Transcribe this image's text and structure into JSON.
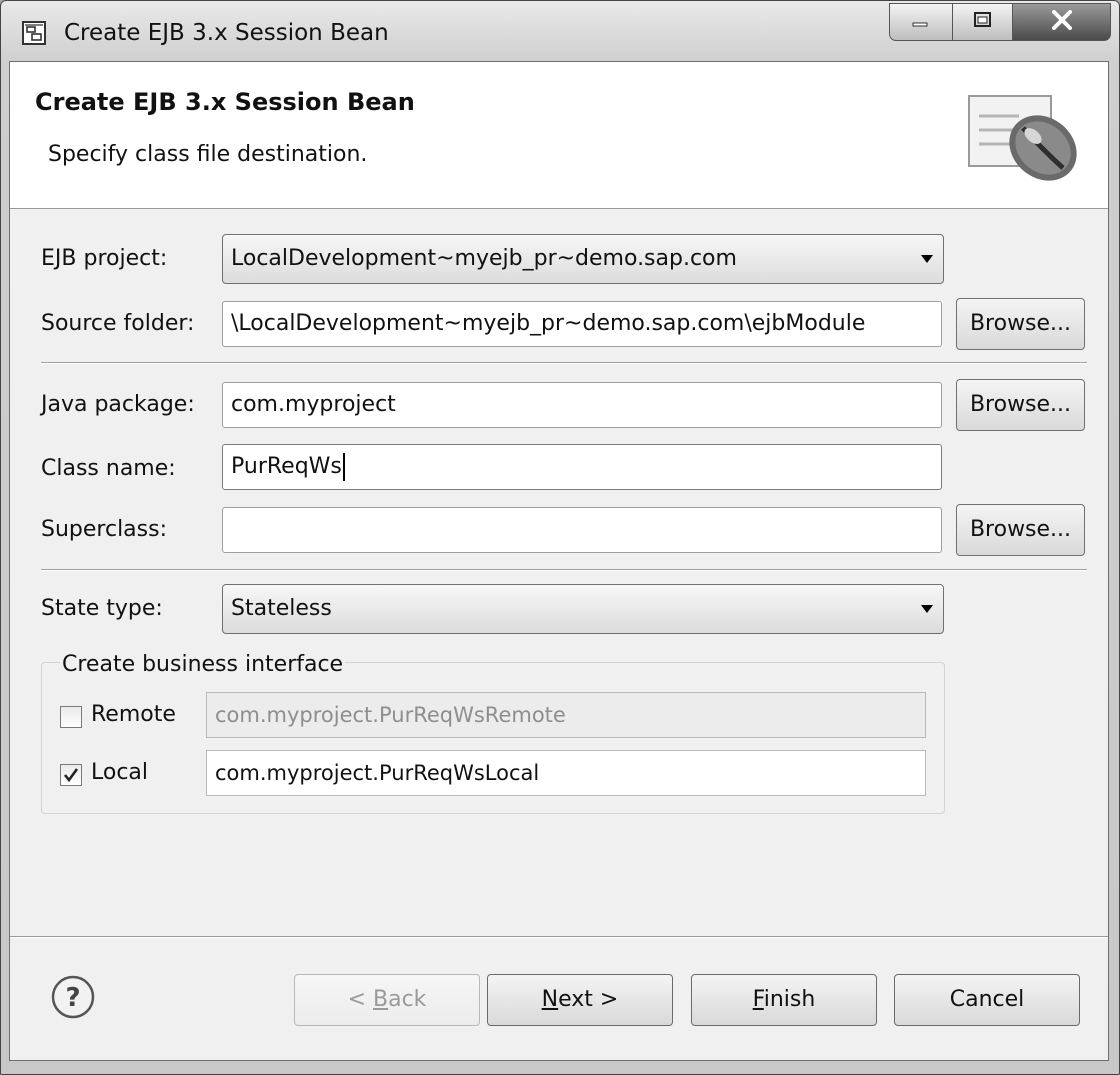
{
  "window": {
    "title": "Create EJB 3.x Session Bean"
  },
  "banner": {
    "title": "Create EJB 3.x Session Bean",
    "subtitle": "Specify class file destination."
  },
  "form": {
    "ejb_project": {
      "label": "EJB project:",
      "value": "LocalDevelopment~myejb_pr~demo.sap.com"
    },
    "source_folder": {
      "label": "Source folder:",
      "value": "\\LocalDevelopment~myejb_pr~demo.sap.com\\ejbModule",
      "browse": "Browse..."
    },
    "java_package": {
      "label": "Java package:",
      "value": "com.myproject",
      "browse": "Browse..."
    },
    "class_name": {
      "label": "Class name:",
      "value": "PurReqWs"
    },
    "superclass": {
      "label": "Superclass:",
      "value": "",
      "browse": "Browse..."
    },
    "state_type": {
      "label": "State type:",
      "value": "Stateless"
    },
    "business_interface": {
      "title": "Create business interface",
      "remote": {
        "label": "Remote",
        "checked": false,
        "value": "com.myproject.PurReqWsRemote"
      },
      "local": {
        "label": "Local",
        "checked": true,
        "value": "com.myproject.PurReqWsLocal"
      }
    }
  },
  "buttons": {
    "back": {
      "prefix": "< ",
      "mnemonic": "B",
      "rest": "ack"
    },
    "next": {
      "mnemonic": "N",
      "rest": "ext >"
    },
    "finish": {
      "mnemonic": "F",
      "rest": "inish"
    },
    "cancel": "Cancel"
  },
  "icons": {
    "title": "wizard-window-icon",
    "banner": "bean-icon",
    "help": "help-icon"
  }
}
